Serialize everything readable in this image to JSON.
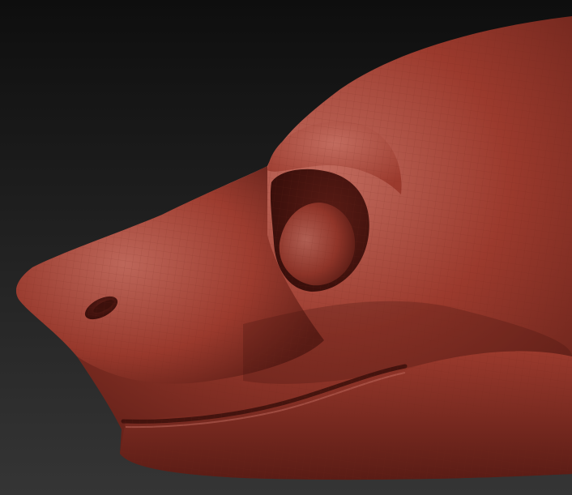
{
  "scene": {
    "subject": "sculpted-animal-head-side-view",
    "colors": {
      "background_top": "#0e0e0e",
      "background_bottom": "#353535",
      "clay_highlight": "#c26c5f",
      "clay_mid": "#9b3a2d",
      "clay_shadow": "#5a1c15",
      "clay_deep": "#3a0f0b",
      "wireframe": "#6e241b"
    }
  }
}
